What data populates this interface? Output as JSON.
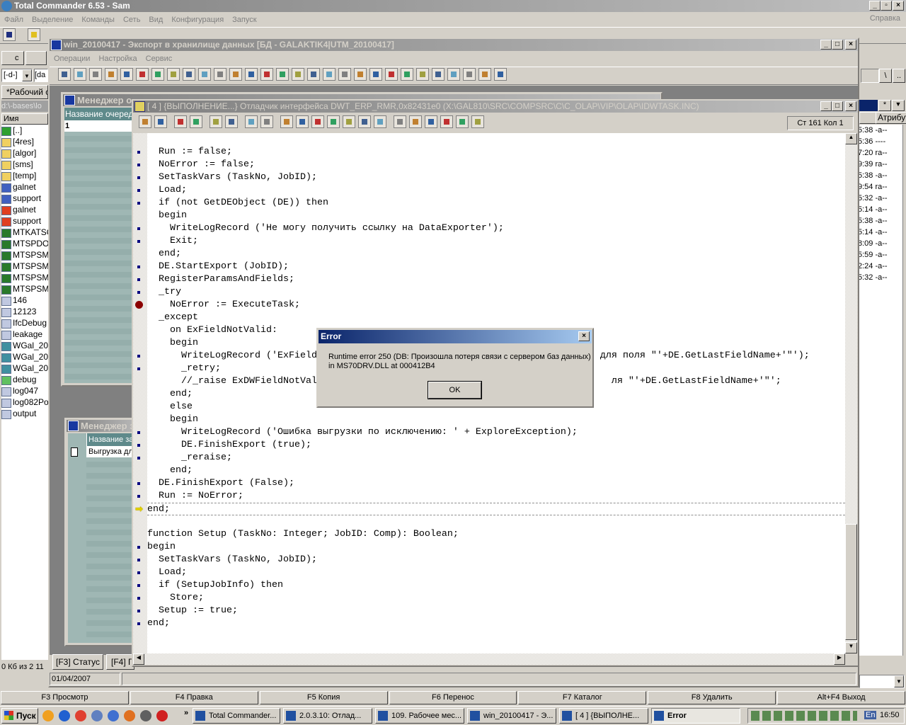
{
  "tc": {
    "title": "Total Commander 6.53 - Sam",
    "menu": [
      "Файл",
      "Выделение",
      "Команды",
      "Сеть",
      "Вид",
      "Конфигурация",
      "Запуск"
    ],
    "help": "Справка",
    "drive_c": "c",
    "drive_combo": "[-d-]",
    "drive_combo2": "[da",
    "tab": "*Рабочий с",
    "path": "d:\\-bases\\lo",
    "col_name": "Имя",
    "col_attr": "Атрибут",
    "status": "0 Кб из 2 11",
    "root_btn": "\\",
    "up_btn": "..",
    "star_btn": "*",
    "files": [
      {
        "name": "[..]",
        "icon": "up-arrow-icon"
      },
      {
        "name": "[4res]",
        "icon": "folder-icon"
      },
      {
        "name": "[algor]",
        "icon": "folder-icon"
      },
      {
        "name": "[sms]",
        "icon": "folder-icon"
      },
      {
        "name": "[temp]",
        "icon": "folder-icon"
      },
      {
        "name": "galnet",
        "icon": "window-icon"
      },
      {
        "name": "support",
        "icon": "window-icon"
      },
      {
        "name": "galnet",
        "icon": "network-icon"
      },
      {
        "name": "support",
        "icon": "network-icon"
      },
      {
        "name": "MTKATSC",
        "icon": "excel-icon"
      },
      {
        "name": "MTSPDOA",
        "icon": "excel-icon"
      },
      {
        "name": "MTSPSMA",
        "icon": "excel-icon"
      },
      {
        "name": "MTSPSMA",
        "icon": "excel-icon"
      },
      {
        "name": "MTSPSMA",
        "icon": "excel-icon"
      },
      {
        "name": "MTSPSMA",
        "icon": "excel-icon"
      },
      {
        "name": "146",
        "icon": "code-file-icon"
      },
      {
        "name": "12123",
        "icon": "code-file-icon"
      },
      {
        "name": "IfcDebug",
        "icon": "code-file-icon"
      },
      {
        "name": "leakage",
        "icon": "code-file-icon"
      },
      {
        "name": "WGal_20",
        "icon": "app-file-icon"
      },
      {
        "name": "WGal_20",
        "icon": "app-file-icon"
      },
      {
        "name": "WGal_20",
        "icon": "app-file-icon"
      },
      {
        "name": "debug",
        "icon": "res-file-icon"
      },
      {
        "name": "log047",
        "icon": "code-file-icon"
      },
      {
        "name": "log082Po",
        "icon": "code-file-icon"
      },
      {
        "name": "output",
        "icon": "code-file-icon"
      }
    ],
    "right_rows": [
      "5:38 -a--",
      "5:36 ----",
      "7:20 ra--",
      "9:39 ra--",
      "5:38 -a--",
      "9:54 ra--",
      "5:32 -a--",
      "5:14 -a--",
      "5:38 -a--",
      "5:14 -a--",
      "8:09 -a--",
      "5:59 -a--",
      "2:24 -a--",
      "5:32 -a--"
    ],
    "fkeys": [
      "F3 Просмотр",
      "F4 Правка",
      "F5 Копия",
      "F6 Перенос",
      "F7 Каталог",
      "F8 Удалить",
      "Alt+F4 Выход"
    ]
  },
  "gal": {
    "title": "win_20100417 - Экспорт в хранилище данных [БД - GALAKTIK4|UTM_20100417]",
    "menu": [
      "Операции",
      "Настройка",
      "Сервис"
    ],
    "toolbar": [
      "edit-icon",
      "preview-icon",
      "blank-icon",
      "edit2-icon",
      "copy-icon",
      "paste-icon",
      "cut-icon",
      "print-preview-icon",
      "undo-icon",
      "redo-icon",
      "export-icon",
      "print-icon",
      "print-setup-icon",
      "print-config-icon",
      "wrench-icon",
      "formula-icon",
      "calculator-icon",
      "help-icon",
      "window-icon",
      "close-window-icon",
      "list-icon",
      "user-icon",
      "schedule-icon",
      "find-icon",
      "find-next-icon",
      "clear-icon",
      "blank-icon",
      "sort-icon",
      "blank-icon"
    ],
    "tabs": [
      "[F3] Статус",
      "[F4] Г"
    ],
    "status_date": "01/04/2007",
    "queue_mgr": {
      "title": "Менеджер о",
      "col": "Название очереди",
      "row": "1"
    },
    "task_mgr": {
      "title": "Менеджер з",
      "col": "Название за",
      "row": "Выгрузка дл"
    }
  },
  "dbg": {
    "title": "[ 4 ]  {ВЫПОЛНЕНИЕ...} Отладчик интерфейса DWT_ERP_RMR,0x82431e0 (X:\\GAL810\\SRC\\COMPSRC\\C\\C_OLAP\\VIP\\OLAP\\IDWTASK.INC)",
    "position": "Ст 161  Кол 1",
    "toolbar": [
      "run-icon",
      "stop-icon",
      "hand-icon",
      "step-arrow-icon",
      "step-into-icon",
      "step-out-icon",
      "trace-icon",
      "trace-back-icon",
      "breakpoint-hand-icon",
      "watch-glasses-icon",
      "evaluate-icon",
      "call-stack-icon",
      "windows-icon",
      "table-icon",
      "info-icon",
      "gauge-icon",
      "bp-set-icon",
      "bp-cond-icon",
      "bp-stop-icon",
      "bp-clear-icon",
      "bp-clear-all-icon"
    ],
    "lines": [
      {
        "t": "  Run := false;",
        "m": "dot"
      },
      {
        "t": "  NoError := false;",
        "m": "dot"
      },
      {
        "t": "  SetTaskVars (TaskNo, JobID);",
        "m": "dot"
      },
      {
        "t": "  Load;",
        "m": "dot"
      },
      {
        "t": "  if (not GetDEObject (DE)) then",
        "m": "dot"
      },
      {
        "t": "  begin",
        "m": ""
      },
      {
        "t": "    WriteLogRecord ('Не могу получить ссылку на DataExporter');",
        "m": "dot"
      },
      {
        "t": "    Exit;",
        "m": "dot"
      },
      {
        "t": "  end;",
        "m": ""
      },
      {
        "t": "  DE.StartExport (JobID);",
        "m": "dot"
      },
      {
        "t": "  RegisterParamsAndFields;",
        "m": "dot"
      },
      {
        "t": "  _try",
        "m": "dot"
      },
      {
        "t": "    NoError := ExecuteTask;",
        "m": "bp"
      },
      {
        "t": "  _except",
        "m": ""
      },
      {
        "t": "    on ExFieldNotValid:",
        "m": ""
      },
      {
        "t": "    begin",
        "m": ""
      },
      {
        "t": "      WriteLogRecord ('ExField                                                  для поля \"'+DE.GetLastFieldName+'\"');",
        "m": "dot"
      },
      {
        "t": "      _retry;",
        "m": "dot"
      },
      {
        "t": "      //_raise ExDWFieldNotVal                                                    ля \"'+DE.GetLastFieldName+'\"';",
        "m": ""
      },
      {
        "t": "    end;",
        "m": ""
      },
      {
        "t": "    else",
        "m": ""
      },
      {
        "t": "    begin",
        "m": ""
      },
      {
        "t": "      WriteLogRecord ('Ошибка выгрузки по исключению: ' + ExploreException);",
        "m": "dot"
      },
      {
        "t": "      DE.FinishExport (true);",
        "m": "dot"
      },
      {
        "t": "      _reraise;",
        "m": "dot"
      },
      {
        "t": "    end;",
        "m": ""
      },
      {
        "t": "  DE.FinishExport (False);",
        "m": "dot"
      },
      {
        "t": "  Run := NoError;",
        "m": "dot"
      },
      {
        "t": "end;",
        "m": "arrow"
      },
      {
        "t": "",
        "m": ""
      },
      {
        "t": "function Setup (TaskNo: Integer; JobID: Comp): Boolean;",
        "m": ""
      },
      {
        "t": "begin",
        "m": "dot"
      },
      {
        "t": "  SetTaskVars (TaskNo, JobID);",
        "m": "dot"
      },
      {
        "t": "  Load;",
        "m": "dot"
      },
      {
        "t": "  if (SetupJobInfo) then",
        "m": "dot"
      },
      {
        "t": "    Store;",
        "m": "dot"
      },
      {
        "t": "  Setup := true;",
        "m": "dot"
      },
      {
        "t": "end;",
        "m": "dot"
      }
    ]
  },
  "dialog": {
    "title": "Error",
    "line1": "Runtime error 250 (DB: Произошла потеря связи с сервером баз данных)",
    "line2": "in MS70DRV.DLL at 000412B4",
    "ok": "OK"
  },
  "taskbar": {
    "start": "Пуск",
    "quick": [
      "flower-icon",
      "ie-icon",
      "chrome-icon",
      "notepad-icon",
      "app-icon",
      "firefox-icon",
      "calc-icon",
      "acrobat-icon"
    ],
    "more": "»",
    "tasks": [
      "Total Commander...",
      "2.0.3.10: Отлад...",
      "109. Рабочее мес...",
      "win_20100417 - Э...",
      "[ 4 ]  {ВЫПОЛНЕ...",
      "Error"
    ],
    "active_task": 5,
    "lang": "En",
    "clock": "16:50"
  },
  "colors": {
    "title_inactive": "#808080",
    "title_active": "#0a246a",
    "breakpoint": "#8b0000",
    "dot": "#000080",
    "panel_teal": "#9fb7b4"
  }
}
